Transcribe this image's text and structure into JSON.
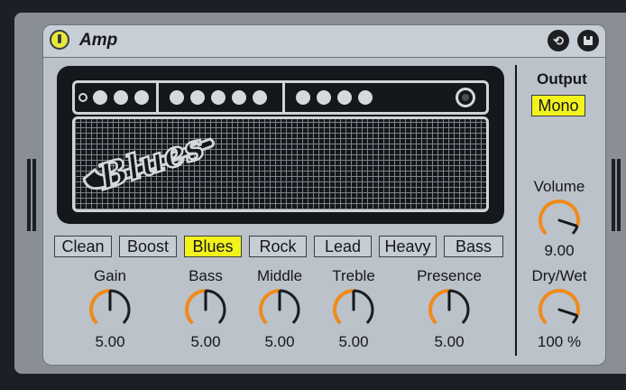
{
  "device": {
    "title": "Amp",
    "icons": {
      "power": "power-icon",
      "hot_swap": "hot-swap-icon",
      "save": "save-preset-icon"
    }
  },
  "amp_badge": {
    "text": "Blues"
  },
  "presets": {
    "items": [
      "Clean",
      "Boost",
      "Blues",
      "Rock",
      "Lead",
      "Heavy",
      "Bass"
    ],
    "selected": "Blues"
  },
  "knobs": {
    "gain": {
      "label": "Gain",
      "value": "5.00"
    },
    "bass": {
      "label": "Bass",
      "value": "5.00"
    },
    "middle": {
      "label": "Middle",
      "value": "5.00"
    },
    "treble": {
      "label": "Treble",
      "value": "5.00"
    },
    "presence": {
      "label": "Presence",
      "value": "5.00"
    },
    "volume": {
      "label": "Volume",
      "value": "9.00"
    },
    "dry_wet": {
      "label": "Dry/Wet",
      "value": "100 %"
    }
  },
  "output": {
    "label": "Output",
    "mode": "Mono"
  },
  "colors": {
    "accent_yellow": "#f2f21c",
    "knob_arc_orange": "#f08a1a",
    "knob_track_dark": "#1b1e22",
    "panel": "#bbc2ca"
  }
}
